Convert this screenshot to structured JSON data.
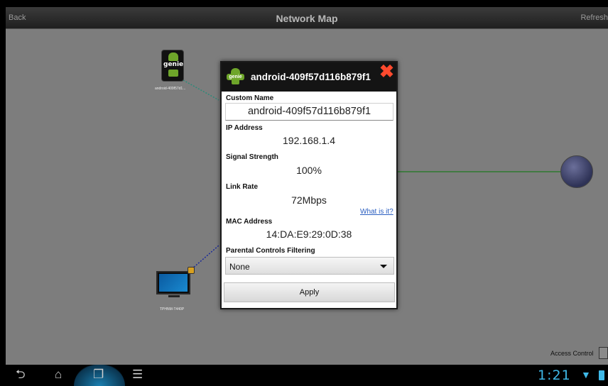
{
  "titlebar": {
    "back_label": "Back",
    "title": "Network Map",
    "refresh_label": "Refresh"
  },
  "map": {
    "phone_device": {
      "icon_text": "genie",
      "label": "android-409f57d1..."
    },
    "tv_device": {
      "label": "TPHNM-T440P"
    },
    "access_control_label": "Access Control"
  },
  "dialog": {
    "title": "android-409f57d116b879f1",
    "app_icon_text": "genie",
    "custom_name_label": "Custom Name",
    "custom_name_value": "android-409f57d116b879f1",
    "ip_label": "IP Address",
    "ip_value": "192.168.1.4",
    "signal_label": "Signal Strength",
    "signal_value": "100%",
    "link_rate_label": "Link Rate",
    "link_rate_value": "72Mbps",
    "what_is_it_link": "What is it?",
    "mac_label": "MAC Address",
    "mac_value": "14:DA:E9:29:0D:38",
    "parental_label": "Parental Controls Filtering",
    "parental_selected": "None",
    "apply_label": "Apply"
  },
  "navbar": {
    "clock": "1:21",
    "icons": [
      "back-icon",
      "home-icon",
      "recent-apps-icon",
      "menu-icon"
    ]
  },
  "colors": {
    "map_bg": "#7d7d7d",
    "close_x": "#ff4a2e",
    "link_blue": "#2a5ec0",
    "clock_blue": "#3fb9e8",
    "router_link_green": "#2e7a30"
  }
}
